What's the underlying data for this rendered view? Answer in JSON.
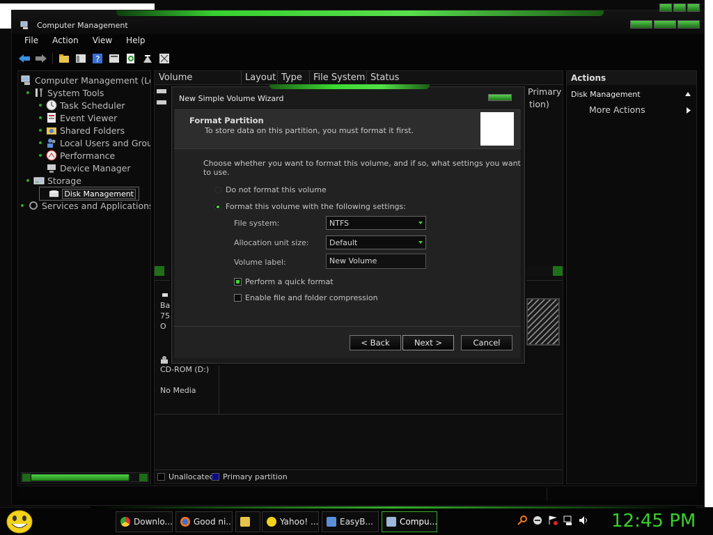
{
  "window": {
    "title": "Computer Management"
  },
  "menu": [
    "File",
    "Action",
    "View",
    "Help"
  ],
  "tree": [
    {
      "label": "Computer Management (Loc",
      "indent": 0,
      "icon": "computer-icon"
    },
    {
      "label": "System Tools",
      "indent": 1,
      "icon": "tools-icon"
    },
    {
      "label": "Task Scheduler",
      "indent": 2,
      "icon": "clock-icon"
    },
    {
      "label": "Event Viewer",
      "indent": 2,
      "icon": "event-viewer-icon"
    },
    {
      "label": "Shared Folders",
      "indent": 2,
      "icon": "shared-folder-icon"
    },
    {
      "label": "Local Users and Grou",
      "indent": 2,
      "icon": "users-icon"
    },
    {
      "label": "Performance",
      "indent": 2,
      "icon": "performance-icon"
    },
    {
      "label": "Device Manager",
      "indent": 2,
      "icon": "device-manager-icon"
    },
    {
      "label": "Storage",
      "indent": 1,
      "icon": "storage-icon"
    },
    {
      "label": "Disk Management",
      "indent": 2,
      "icon": "disk-icon",
      "selected": true
    },
    {
      "label": "Services and Applications",
      "indent": 1,
      "icon": "services-icon"
    }
  ],
  "columns": [
    "Volume",
    "Layout",
    "Type",
    "File System",
    "Status"
  ],
  "partial_right": [
    "Primary",
    "tion)"
  ],
  "disk_labels": {
    "b": "Ba",
    "size": "75",
    "o": "O",
    "cdrom": "CD-ROM (D:)",
    "nomedia": "No Media"
  },
  "legend": {
    "unallocated": "Unallocated",
    "primary": "Primary partition",
    "colors": {
      "unallocated": "#000000",
      "primary": "#0a0a8a"
    }
  },
  "actions": {
    "header": "Actions",
    "section": "Disk Management",
    "more": "More Actions"
  },
  "dialog": {
    "title": "New Simple Volume Wizard",
    "heading": "Format Partition",
    "subheading": "To store data on this partition, you must format it first.",
    "instruction": "Choose whether you want to format this volume, and if so, what settings you want to use.",
    "radio_no_format": "Do not format this volume",
    "radio_format": "Format this volume with the following settings:",
    "fs_label": "File system:",
    "fs_value": "NTFS",
    "alloc_label": "Allocation unit size:",
    "alloc_value": "Default",
    "vol_label": "Volume label:",
    "vol_value": "New Volume",
    "quick_format": "Perform a quick format",
    "quick_format_checked": true,
    "compression": "Enable file and folder compression",
    "compression_checked": false,
    "back": "< Back",
    "next": "Next >",
    "cancel": "Cancel"
  },
  "taskbar": {
    "tasks": [
      {
        "label": "Downlo...",
        "icon": "chrome-icon"
      },
      {
        "label": "Good ni...",
        "icon": "firefox-icon"
      },
      {
        "label": "",
        "icon": "folder-icon"
      },
      {
        "label": "Yahoo! ...",
        "icon": "yahoo-messenger-icon"
      },
      {
        "label": "EasyB...",
        "icon": "easybcd-icon"
      },
      {
        "label": "Compu...",
        "icon": "computer-management-icon",
        "active": true
      }
    ],
    "clock": "12:45 PM"
  },
  "accent_color": "#3ed334"
}
